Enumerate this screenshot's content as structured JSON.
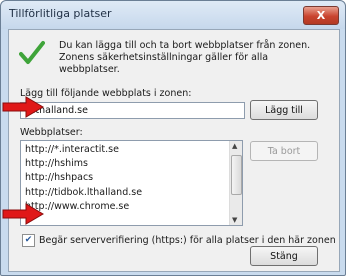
{
  "window": {
    "title": "Tillförlitliga platser",
    "close_glyph": "X"
  },
  "intro": {
    "text": "Du kan lägga till och ta bort webbplatser från zonen. Zonens säkerhetsinställningar gäller för alla webbplatser."
  },
  "add_section": {
    "label": "Lägg till följande webbplats i zonen:",
    "input_value": "*.lthalland.se",
    "add_button": "Lägg till"
  },
  "sites_section": {
    "label": "Webbplatser:",
    "items": [
      "http://*.interactit.se",
      "http://hshims",
      "http://hshpacs",
      "http://tidbok.lthalland.se",
      "http://www.chrome.se"
    ],
    "remove_button": "Ta bort"
  },
  "checkbox": {
    "label": "Begär serververifiering (https:) för alla platser i den här zonen",
    "checked": true
  },
  "footer": {
    "close_button": "Stäng"
  },
  "colors": {
    "arrow_red": "#e01818",
    "check_green": "#3fa43a"
  }
}
